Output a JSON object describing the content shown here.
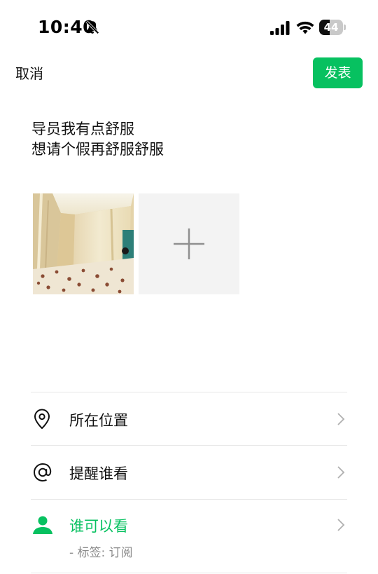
{
  "status_bar": {
    "time": "10:40",
    "battery_level": "44",
    "battery_fraction": 0.44
  },
  "nav": {
    "cancel_label": "取消",
    "publish_label": "发表",
    "accent_color": "#07c160"
  },
  "post": {
    "lines": [
      "导员我有点舒服",
      "想请个假再舒服舒服"
    ]
  },
  "media": {
    "photo_alt": "bed curtain photo",
    "add_icon": "plus-icon"
  },
  "options": {
    "location": {
      "label": "所在位置",
      "icon": "location-pin-icon"
    },
    "mention": {
      "label": "提醒谁看",
      "icon": "at-icon"
    },
    "visibility": {
      "label": "谁可以看",
      "sub": "- 标签: 订阅",
      "icon": "person-icon"
    }
  }
}
